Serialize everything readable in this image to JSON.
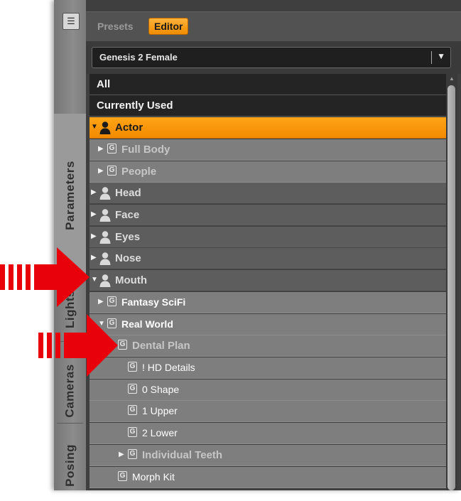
{
  "side_tabs": [
    {
      "label": "Parameters"
    },
    {
      "label": "Lights"
    },
    {
      "label": "Cameras"
    },
    {
      "label": "Posing"
    }
  ],
  "header": {
    "presets_label": "Presets",
    "editor_label": "Editor"
  },
  "selector": {
    "value": "Genesis 2 Female",
    "arrow": "▼"
  },
  "tree": {
    "all_label": "All",
    "currently_used_label": "Currently Used",
    "actor_label": "Actor",
    "full_body_label": "Full Body",
    "people_label": "People",
    "head_label": "Head",
    "face_label": "Face",
    "eyes_label": "Eyes",
    "nose_label": "Nose",
    "mouth_label": "Mouth",
    "fantasy_scifi_label": "Fantasy SciFi",
    "real_world_label": "Real World",
    "dental_plan_label": "Dental Plan",
    "hd_details_label": "! HD Details",
    "shape_label": "0 Shape",
    "upper_label": "1 Upper",
    "lower_label": "2 Lower",
    "individual_teeth_label": "Individual Teeth",
    "morph_kit_label": "Morph Kit"
  },
  "icons": {
    "group_letter": "G",
    "expand": "▶",
    "collapse": "▼"
  },
  "colors": {
    "accent": "#f59200",
    "callout": "#e8000b"
  }
}
